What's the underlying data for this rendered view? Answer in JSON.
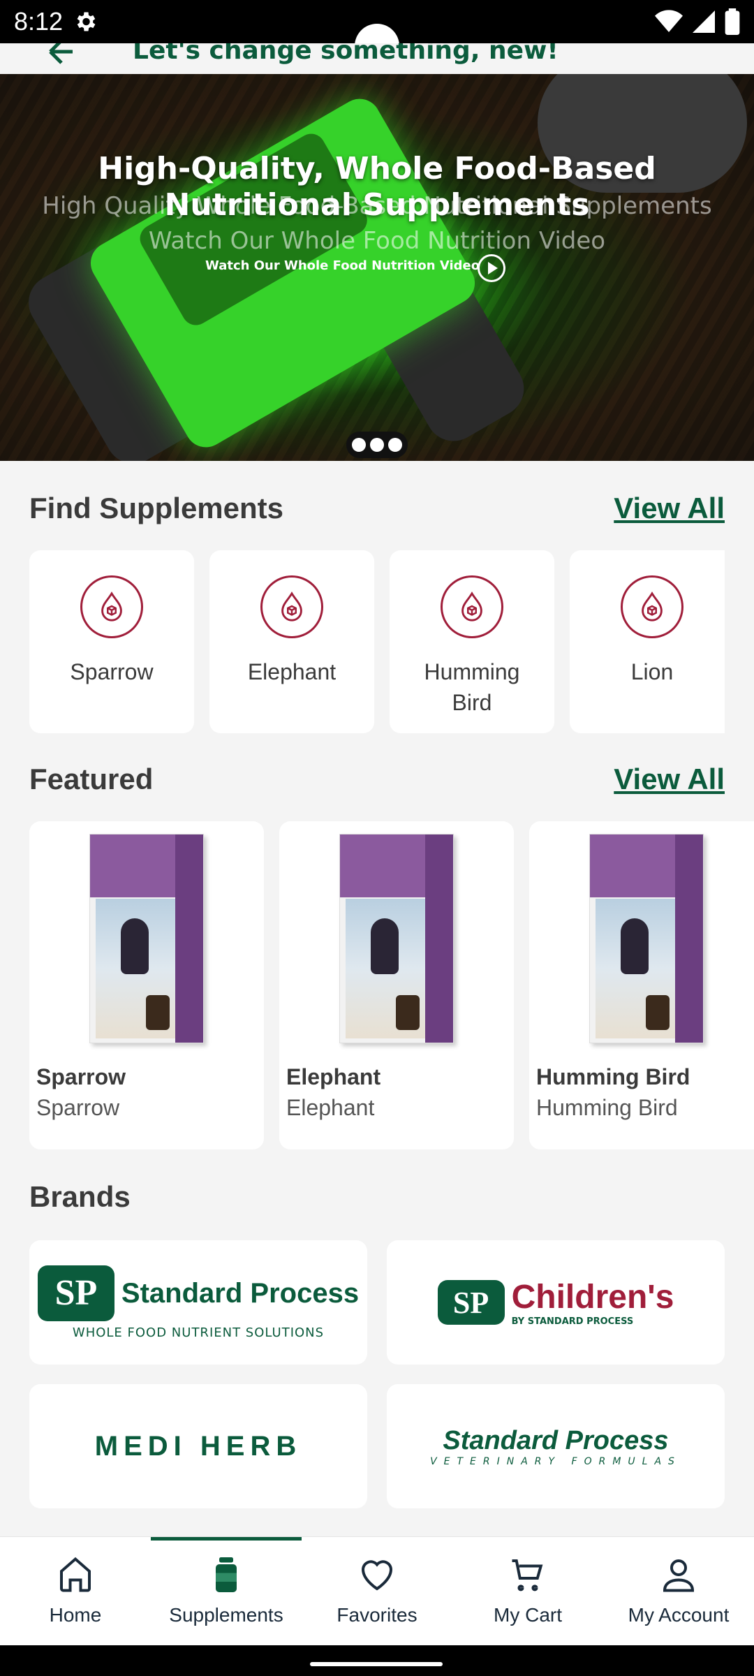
{
  "status_bar": {
    "time": "8:12"
  },
  "header": {
    "title": "Let's change something, new!"
  },
  "hero": {
    "title": "High-Quality, Whole Food-Based Nutritional Supplements",
    "subtitle": "High Quality Whole Food-Based Nutritional Supplements",
    "subtitle2": "Watch Our Whole Food Nutrition Video",
    "video_label": "Watch Our Whole Food Nutrition Video",
    "slides": 3
  },
  "find_supplements": {
    "title": "Find Supplements",
    "view_all": "View All",
    "items": [
      {
        "label": "Sparrow"
      },
      {
        "label": "Elephant"
      },
      {
        "label": "Humming Bird"
      },
      {
        "label": "Lion"
      }
    ]
  },
  "featured": {
    "title": "Featured",
    "view_all": "View All",
    "items": [
      {
        "name": "Sparrow",
        "sub": "Sparrow"
      },
      {
        "name": "Elephant",
        "sub": "Elephant"
      },
      {
        "name": "Humming Bird",
        "sub": "Humming Bird"
      }
    ]
  },
  "brands": {
    "title": "Brands",
    "items": [
      {
        "name": "Standard Process",
        "tagline": "WHOLE FOOD NUTRIENT SOLUTIONS"
      },
      {
        "name": "Children's",
        "tagline": "BY STANDARD PROCESS"
      },
      {
        "name": "MEDI HERB"
      },
      {
        "name": "Standard Process",
        "tagline": "VETERINARY FORMULAS"
      }
    ]
  },
  "bottom_nav": {
    "items": [
      {
        "label": "Home",
        "icon": "home-icon"
      },
      {
        "label": "Supplements",
        "icon": "bottle-icon",
        "active": true
      },
      {
        "label": "Favorites",
        "icon": "heart-icon"
      },
      {
        "label": "My Cart",
        "icon": "cart-icon"
      },
      {
        "label": "My Account",
        "icon": "user-icon"
      }
    ]
  },
  "colors": {
    "brand_green": "#0b5b3c",
    "accent_red": "#a01e3a"
  }
}
